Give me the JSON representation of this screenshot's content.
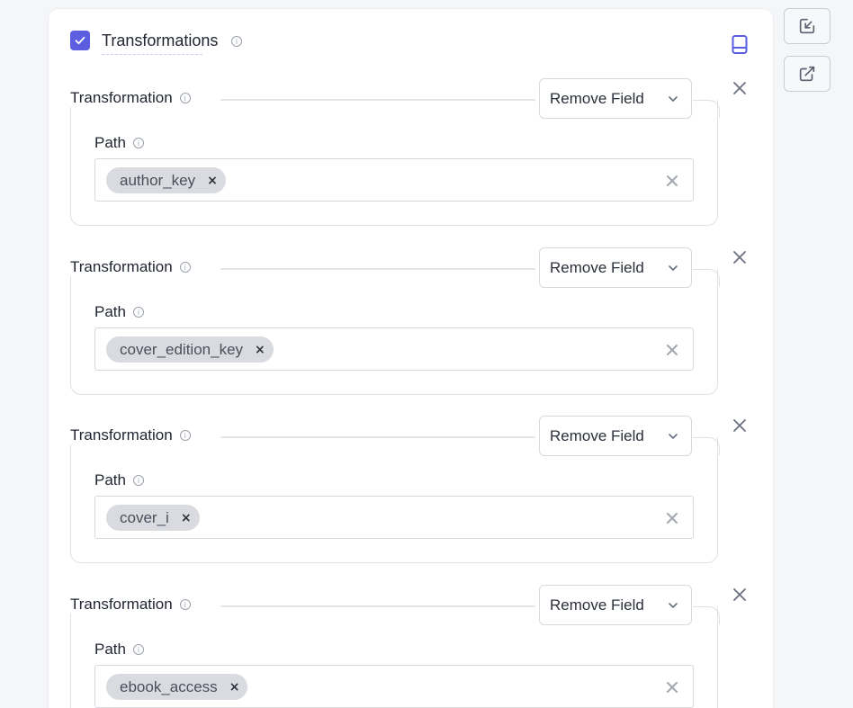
{
  "section": {
    "title": "Transformations",
    "enabled": true
  },
  "transformations": [
    {
      "label": "Transformation",
      "type": "Remove Field",
      "path_label": "Path",
      "path_values": [
        "author_key"
      ]
    },
    {
      "label": "Transformation",
      "type": "Remove Field",
      "path_label": "Path",
      "path_values": [
        "cover_edition_key"
      ]
    },
    {
      "label": "Transformation",
      "type": "Remove Field",
      "path_label": "Path",
      "path_values": [
        "cover_i"
      ]
    },
    {
      "label": "Transformation",
      "type": "Remove Field",
      "path_label": "Path",
      "path_values": [
        "ebook_access"
      ]
    }
  ],
  "colors": {
    "accent": "#5b5ee0",
    "border": "#dfe1e6",
    "chip": "#d9dbe0"
  },
  "icons": {
    "side_top": "edit-square-icon",
    "side_bottom": "external-link-icon",
    "doc": "book-icon",
    "info": "info-icon",
    "remove": "close-icon",
    "dropdown": "chevron-down-icon"
  }
}
